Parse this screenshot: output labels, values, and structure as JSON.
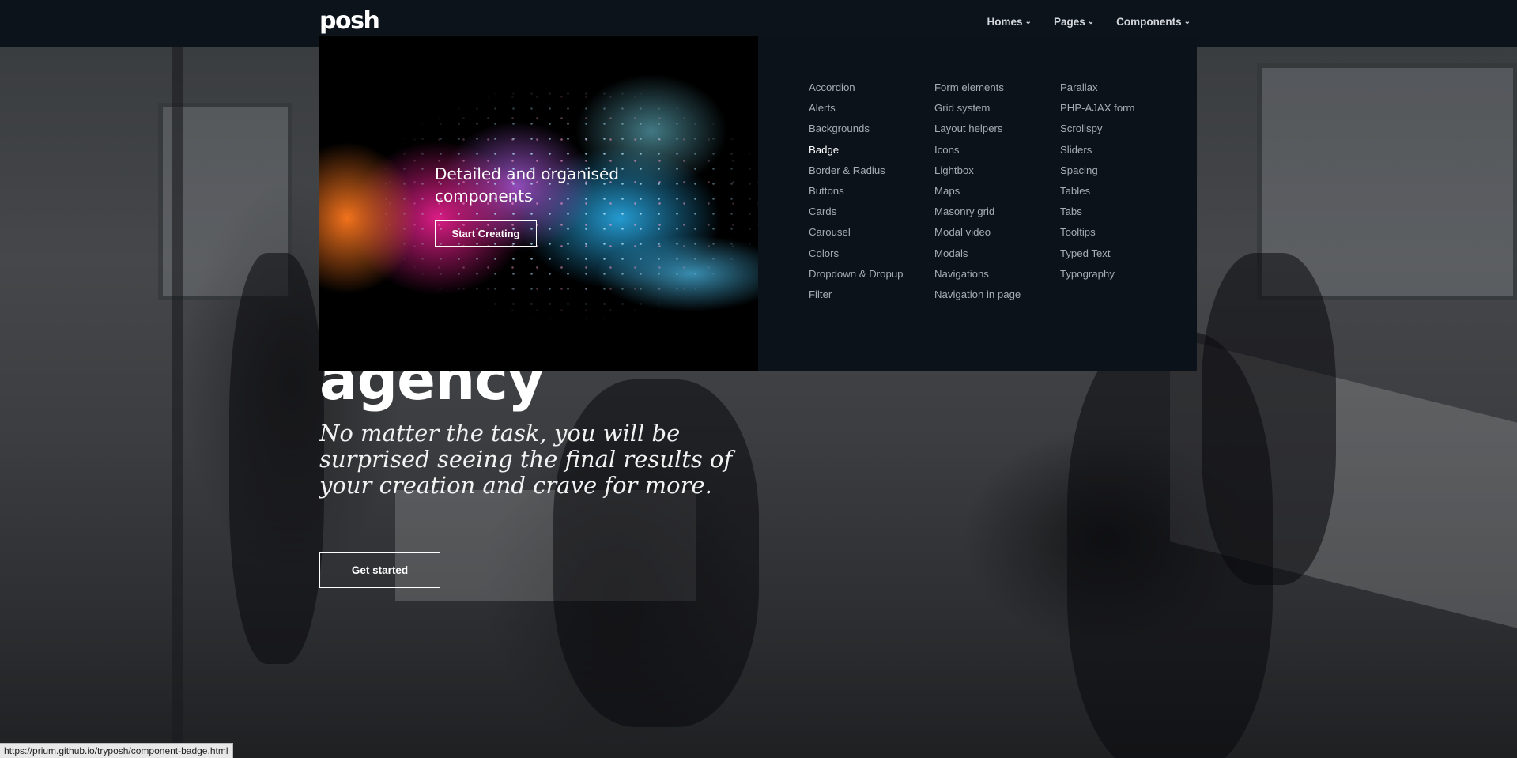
{
  "brand": {
    "logo_text": "posh"
  },
  "nav": {
    "items": [
      {
        "label": "Homes"
      },
      {
        "label": "Pages"
      },
      {
        "label": "Components"
      }
    ]
  },
  "mega_menu": {
    "promo_title": "Detailed and organised components",
    "promo_button": "Start Creating",
    "active_item": "Badge",
    "columns": [
      [
        "Accordion",
        "Alerts",
        "Backgrounds",
        "Badge",
        "Border & Radius",
        "Buttons",
        "Cards",
        "Carousel",
        "Colors",
        "Dropdown & Dropup",
        "Filter"
      ],
      [
        "Form elements",
        "Grid system",
        "Layout helpers",
        "Icons",
        "Lightbox",
        "Maps",
        "Masonry grid",
        "Modal video",
        "Modals",
        "Navigations",
        "Navigation in page"
      ],
      [
        "Parallax",
        "PHP-AJAX form",
        "Scrollspy",
        "Sliders",
        "Spacing",
        "Tables",
        "Tabs",
        "Tooltips",
        "Typed Text",
        "Typography"
      ]
    ]
  },
  "hero": {
    "title_visible": "agency",
    "subtitle": "No matter the task, you will be surprised seeing the final results of your creation and crave for more.",
    "cta": "Get started"
  },
  "status_bar": {
    "url": "https://prium.github.io/tryposh/component-badge.html"
  },
  "colors": {
    "navbar_bg": "#0c131a",
    "dropdown_bg": "#0b121a",
    "link_muted": "#a6adb4",
    "link_active": "#ffffff"
  },
  "icons": {
    "caret": "chevron-down-icon"
  }
}
